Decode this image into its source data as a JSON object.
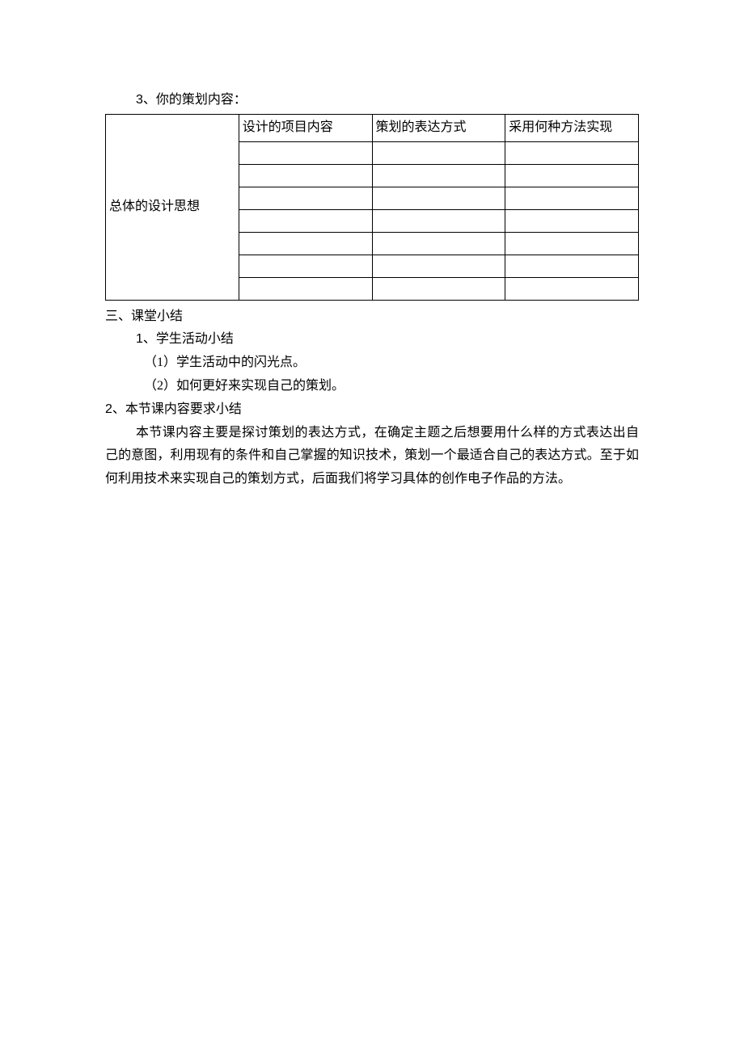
{
  "heading_3": {
    "num": "3",
    "sep": "、",
    "text": "你的策划内容："
  },
  "table": {
    "headers": [
      "总体的设计思想",
      "设计的项目内容",
      "策划的表达方式",
      "采用何种方法实现"
    ],
    "body_rows": 7
  },
  "section_san": {
    "num": "三、",
    "title": "课堂小结"
  },
  "item_1": {
    "num": "1",
    "sep": "、",
    "text": "学生活动小结"
  },
  "item_1_1": {
    "num": "（1）",
    "text": "学生活动中的闪光点。"
  },
  "item_1_2": {
    "num": "（2）",
    "text": "如何更好来实现自己的策划。"
  },
  "item_2": {
    "num": "2",
    "sep": "、",
    "text": "本节课内容要求小结"
  },
  "paragraph": "本节课内容主要是探讨策划的表达方式，在确定主题之后想要用什么样的方式表达出自己的意图，利用现有的条件和自己掌握的知识技术，策划一个最适合自己的表达方式。至于如何利用技术来实现自己的策划方式，后面我们将学习具体的创作电子作品的方法。"
}
